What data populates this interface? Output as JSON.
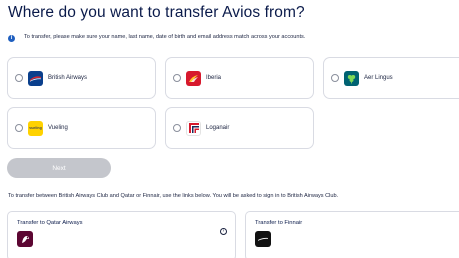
{
  "heading": "Where do you want to transfer Avios from?",
  "notice": "To transfer, please make sure your name, last name, date of birth and email address match across your accounts.",
  "options": [
    {
      "label": "British Airways",
      "icon": "british-airways-logo-icon",
      "color": "#0a3f8c"
    },
    {
      "label": "Iberia",
      "icon": "iberia-logo-icon",
      "color": "#d7192d"
    },
    {
      "label": "Aer Lingus",
      "icon": "aer-lingus-logo-icon",
      "color": "#006272"
    },
    {
      "label": "Vueling",
      "icon": "vueling-logo-icon",
      "color": "#ffd200"
    },
    {
      "label": "Loganair",
      "icon": "loganair-logo-icon",
      "color": "#ffffff"
    }
  ],
  "vueling_logo_text": "vueling",
  "next_label": "Next",
  "transfer_note": "To transfer between British Airways Club and Qatar or Finnair, use the links below. You will be asked to sign in to British Airways Club.",
  "transfers": [
    {
      "label": "Transfer to Qatar Airways",
      "icon": "qatar-airways-logo-icon",
      "color": "#5c0632"
    },
    {
      "label": "Transfer to Finnair",
      "icon": "finnair-logo-icon",
      "color": "#111111"
    }
  ],
  "colors": {
    "accent": "#0a1a4a",
    "info": "#1f5fbf",
    "disabled": "#c4c6cc",
    "border": "#d9dbe3"
  }
}
